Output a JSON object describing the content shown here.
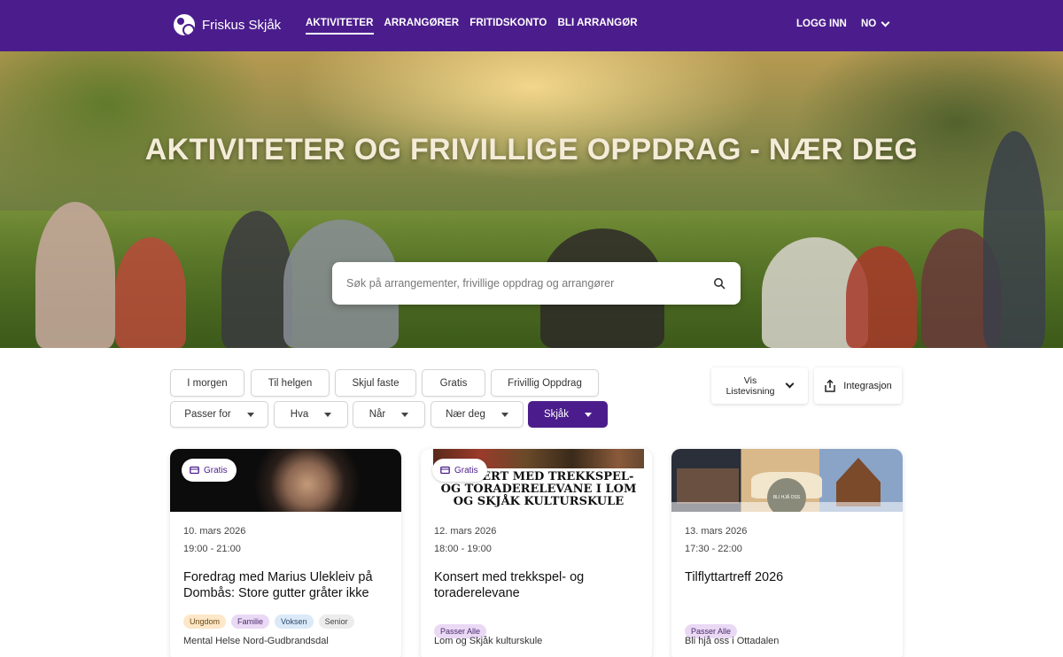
{
  "header": {
    "brand": "Friskus Skjåk",
    "nav": [
      "AKTIVITETER",
      "ARRANGØRER",
      "FRITIDSKONTO",
      "BLI ARRANGØR"
    ],
    "login": "LOGG INN",
    "language": "NO"
  },
  "hero": {
    "title": "AKTIVITETER OG FRIVILLIGE OPPDRAG - NÆR DEG",
    "search_placeholder": "Søk på arrangementer, frivillige oppdrag og arrangører"
  },
  "filters": {
    "quick": [
      "I morgen",
      "Til helgen",
      "Skjul faste",
      "Gratis",
      "Frivillig Oppdrag"
    ],
    "dropdowns": [
      "Passer for",
      "Hva",
      "Når",
      "Nær deg",
      "Skjåk"
    ],
    "view_label_line1": "Vis",
    "view_label_line2": "Listevisning",
    "integration_label": "Integrasjon"
  },
  "cards": [
    {
      "badge": "Gratis",
      "date": "10. mars 2026",
      "time": "19:00 - 21:00",
      "title": "Foredrag med Marius Ulekleiv på Dombås: Store gutter gråter ikke",
      "tags": [
        "Ungdom",
        "Familie",
        "Voksen",
        "Senior"
      ],
      "organizer": "Mental Helse Nord-Gudbrandsdal"
    },
    {
      "badge": "Gratis",
      "poster_text": "KONSERT MED TREKKSPEL- OG TORADERELEVANE I LOM OG SKJÅK KULTURSKULE",
      "date": "12. mars 2026",
      "time": "18:00 - 19:00",
      "title": "Konsert med trekkspel- og toraderelevane",
      "tags": [
        "Passer Alle"
      ],
      "organizer": "Lom og Skjåk kulturskule"
    },
    {
      "logo_text": "BLI HJÅ OSS",
      "date": "13. mars 2026",
      "time": "17:30 - 22:00",
      "title": "Tilflyttartreff 2026",
      "tags": [
        "Passer Alle"
      ],
      "organizer": "Bli hjå oss i Ottadalen"
    }
  ],
  "colors": {
    "brand": "#4b1d8c",
    "hero_text": "#f4ecd8"
  }
}
